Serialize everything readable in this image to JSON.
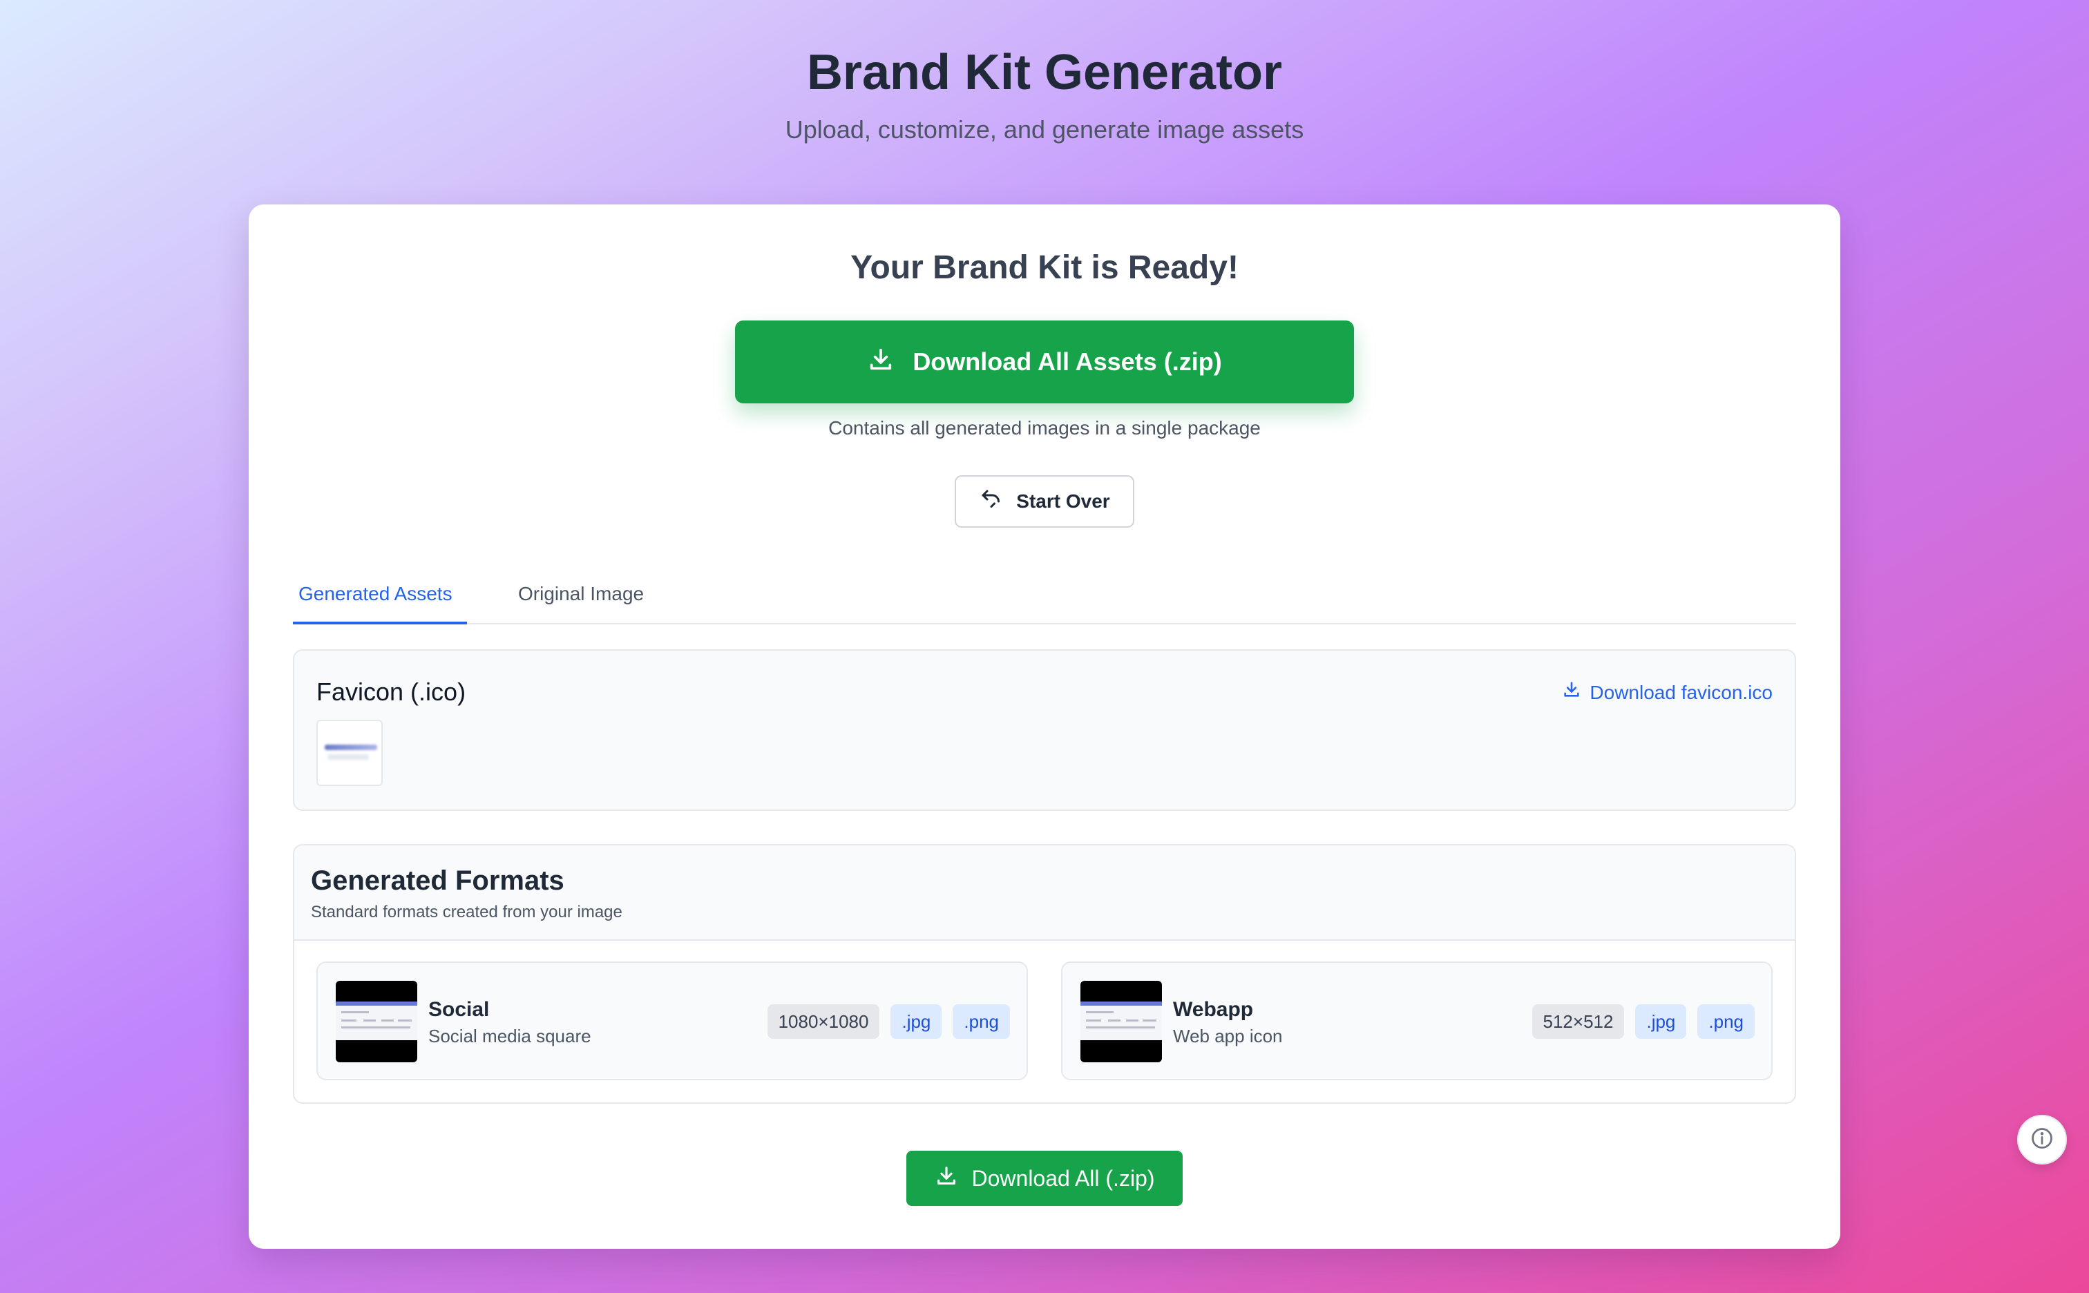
{
  "app": {
    "title": "Brand Kit Generator",
    "subtitle": "Upload, customize, and generate image assets"
  },
  "result": {
    "title": "Your Brand Kit is Ready!",
    "download_all_label": "Download All Assets (.zip)",
    "download_all_caption": "Contains all generated images in a single package",
    "start_over_label": "Start Over"
  },
  "tabs": [
    {
      "label": "Generated Assets",
      "active": true
    },
    {
      "label": "Original Image",
      "active": false
    }
  ],
  "favicon": {
    "title": "Favicon (.ico)",
    "download_label": "Download favicon.ico"
  },
  "formats": {
    "title": "Generated Formats",
    "subtitle": "Standard formats created from your image",
    "items": [
      {
        "name": "Social",
        "description": "Social media square",
        "size": "1080×1080",
        "ext1": ".jpg",
        "ext2": ".png"
      },
      {
        "name": "Webapp",
        "description": "Web app icon",
        "size": "512×512",
        "ext1": ".jpg",
        "ext2": ".png"
      }
    ]
  },
  "footer": {
    "download_all_label": "Download All (.zip)"
  },
  "icons": {
    "download": "download-icon",
    "start_over": "undo-icon",
    "info": "info-icon"
  },
  "colors": {
    "primary_green": "#16a34a",
    "accent_blue": "#2563eb",
    "chip_blue_bg": "#dbeafe"
  }
}
